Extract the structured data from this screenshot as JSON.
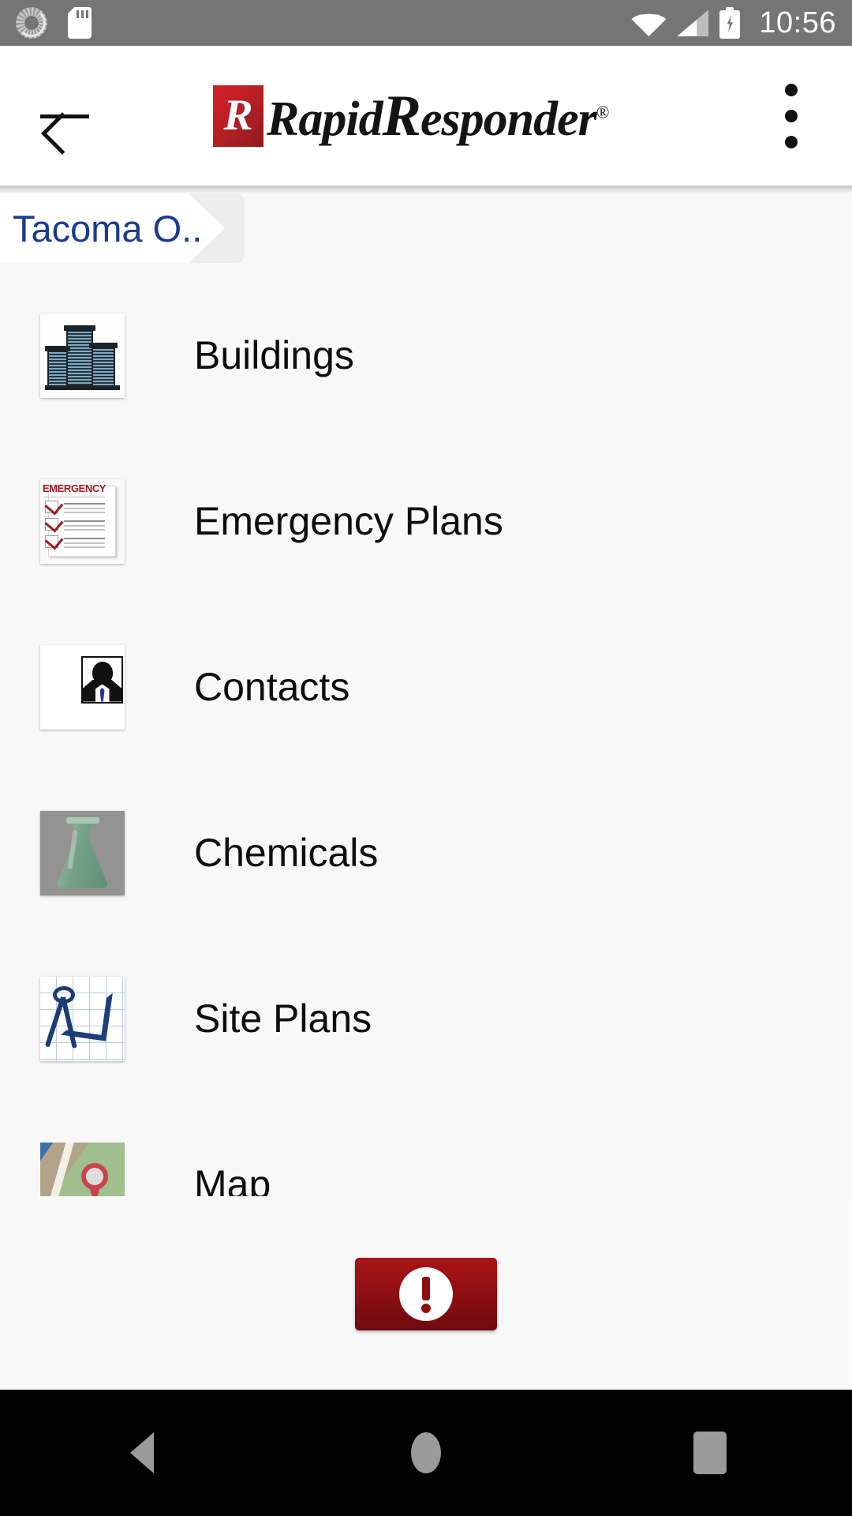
{
  "status_bar": {
    "time": "10:56",
    "icons": [
      "sync-icon",
      "sd-card-icon",
      "wifi-icon",
      "cell-signal-icon",
      "battery-charging-icon"
    ]
  },
  "app_bar": {
    "back_label": "back-arrow-icon",
    "logo_mark_letter": "R",
    "logo_word_1": "Rapid",
    "logo_word_2_initial": "R",
    "logo_word_2_rest": "esponder",
    "registered_mark": "®",
    "overflow_label": "overflow-menu-icon"
  },
  "breadcrumb": {
    "items": [
      {
        "label": "Tacoma O.."
      }
    ]
  },
  "list": {
    "items": [
      {
        "label": "Buildings",
        "icon": "buildings-icon"
      },
      {
        "label": "Emergency Plans",
        "icon": "emergency-plans-icon",
        "icon_text": "EMERGENCY"
      },
      {
        "label": "Contacts",
        "icon": "contacts-icon"
      },
      {
        "label": "Chemicals",
        "icon": "chemicals-flask-icon"
      },
      {
        "label": "Site Plans",
        "icon": "site-plans-icon"
      },
      {
        "label": "Map",
        "icon": "map-icon"
      }
    ]
  },
  "footer": {
    "alert_button_name": "emergency-alert-button",
    "alert_icon": "exclamation-circle-icon"
  },
  "nav_bar": {
    "back": "nav-back-icon",
    "home": "nav-home-icon",
    "recents": "nav-recents-icon"
  },
  "colors": {
    "status_bar": "#757575",
    "app_bar": "#ffffff",
    "breadcrumb_text": "#1b3a8f",
    "brand_red": "#b31f24",
    "alert_red": "#8d0f12",
    "page_background": "#f8f8f8",
    "nav_bar": "#000000"
  }
}
